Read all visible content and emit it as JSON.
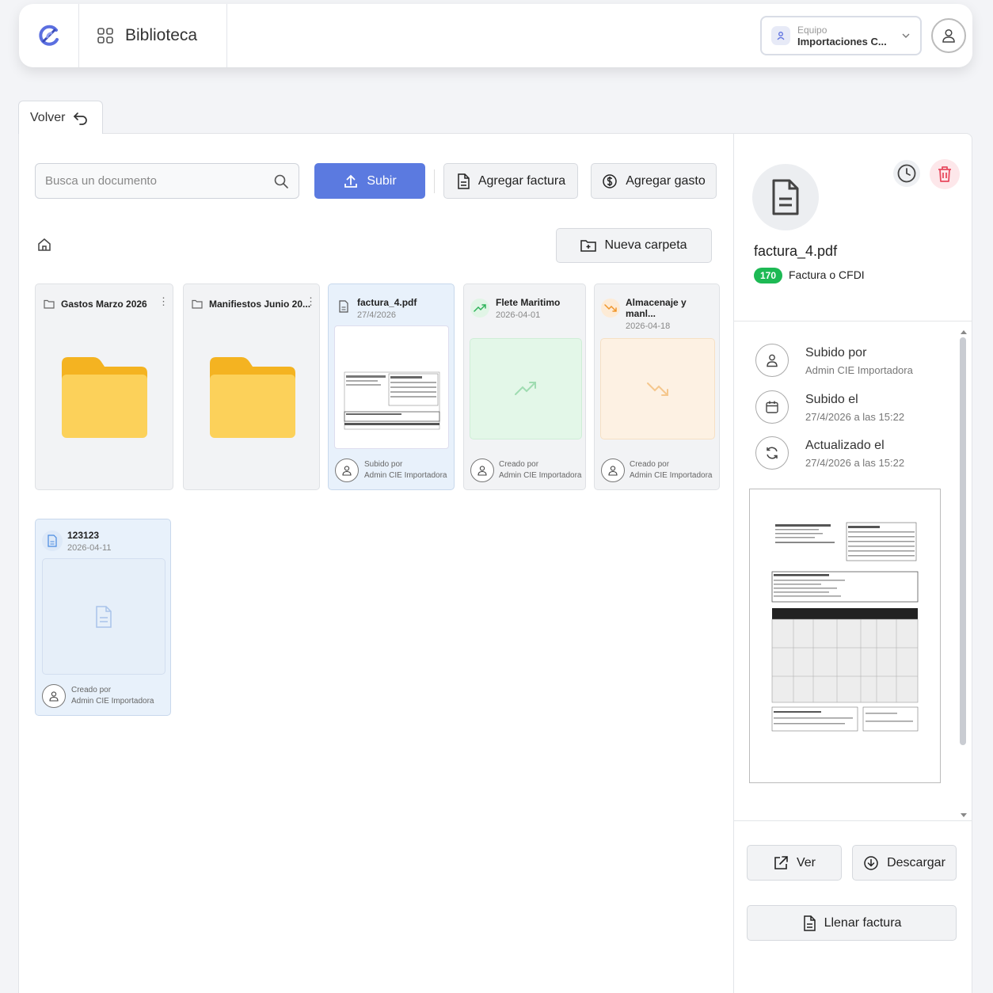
{
  "header": {
    "title": "Biblioteca",
    "team_label": "Equipo",
    "team_name": "Importaciones C..."
  },
  "back_label": "Volver",
  "toolbar": {
    "search_placeholder": "Busca un documento",
    "upload_label": "Subir",
    "add_invoice_label": "Agregar factura",
    "add_expense_label": "Agregar gasto",
    "new_folder_label": "Nueva carpeta"
  },
  "folders": [
    {
      "name": "Gastos Marzo 2026"
    },
    {
      "name": "Manifiestos Junio 20..."
    }
  ],
  "documents": [
    {
      "name": "factura_4.pdf",
      "date": "27/4/2026",
      "by_label": "Subido por",
      "by": "Admin CIE Importadora"
    },
    {
      "name": "Flete Maritimo",
      "date": "2026-04-01",
      "by_label": "Creado por",
      "by": "Admin CIE Importadora"
    },
    {
      "name": "Almacenaje y manl...",
      "date": "2026-04-18",
      "by_label": "Creado por",
      "by": "Admin CIE Importadora"
    },
    {
      "name": "123123",
      "date": "2026-04-11",
      "by_label": "Creado por",
      "by": "Admin CIE Importadora"
    }
  ],
  "detail": {
    "file_name": "factura_4.pdf",
    "badge": "170",
    "type": "Factura o CFDI",
    "uploaded_by_label": "Subido por",
    "uploaded_by": "Admin CIE Importadora",
    "uploaded_on_label": "Subido el",
    "uploaded_on": "27/4/2026 a las 15:22",
    "updated_label": "Actualizado el",
    "updated_on": "27/4/2026 a las 15:22",
    "view_label": "Ver",
    "download_label": "Descargar",
    "fill_label": "Llenar factura"
  },
  "colors": {
    "accent": "#5b7ae0",
    "folder": "#fcd15a",
    "badge": "#1db954",
    "delete": "#e84a5f"
  }
}
